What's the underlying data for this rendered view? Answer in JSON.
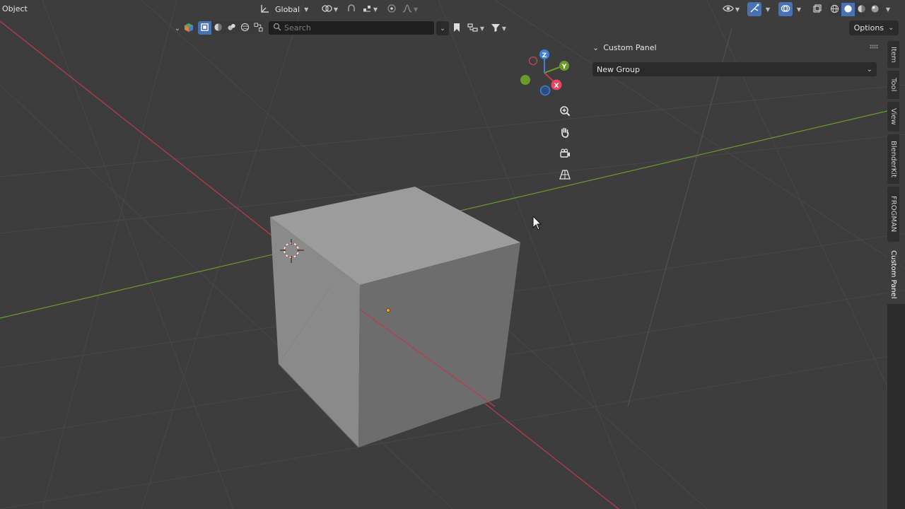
{
  "header": {
    "mode": "Object",
    "orientation": "Global",
    "options_label": "Options"
  },
  "filter": {
    "search_placeholder": "Search"
  },
  "panel": {
    "title": "Custom Panel",
    "group_value": "New Group"
  },
  "sidebar_tabs": [
    {
      "label": "Item"
    },
    {
      "label": "Tool"
    },
    {
      "label": "View"
    },
    {
      "label": "BlenderKit"
    },
    {
      "label": "FROGMAN"
    },
    {
      "label": "Custom Panel"
    }
  ],
  "gizmo": {
    "x_label": "X",
    "y_label": "Y",
    "z_label": "Z"
  },
  "icons": {
    "orientation": "transform-orientation-icon",
    "pivot": "pivot-icon",
    "snap": "snap-magnet-icon",
    "proportional": "proportional-edit-icon",
    "zoom": "zoom-icon",
    "pan": "hand-pan-icon",
    "camera": "camera-view-icon",
    "grid": "perspective-grid-icon"
  },
  "colors": {
    "x_axis": "#c1394b",
    "y_axis": "#6b9a2c",
    "z_axis": "#3f7fd6",
    "accent": "#4772b3",
    "background": "#3d3d3d"
  }
}
